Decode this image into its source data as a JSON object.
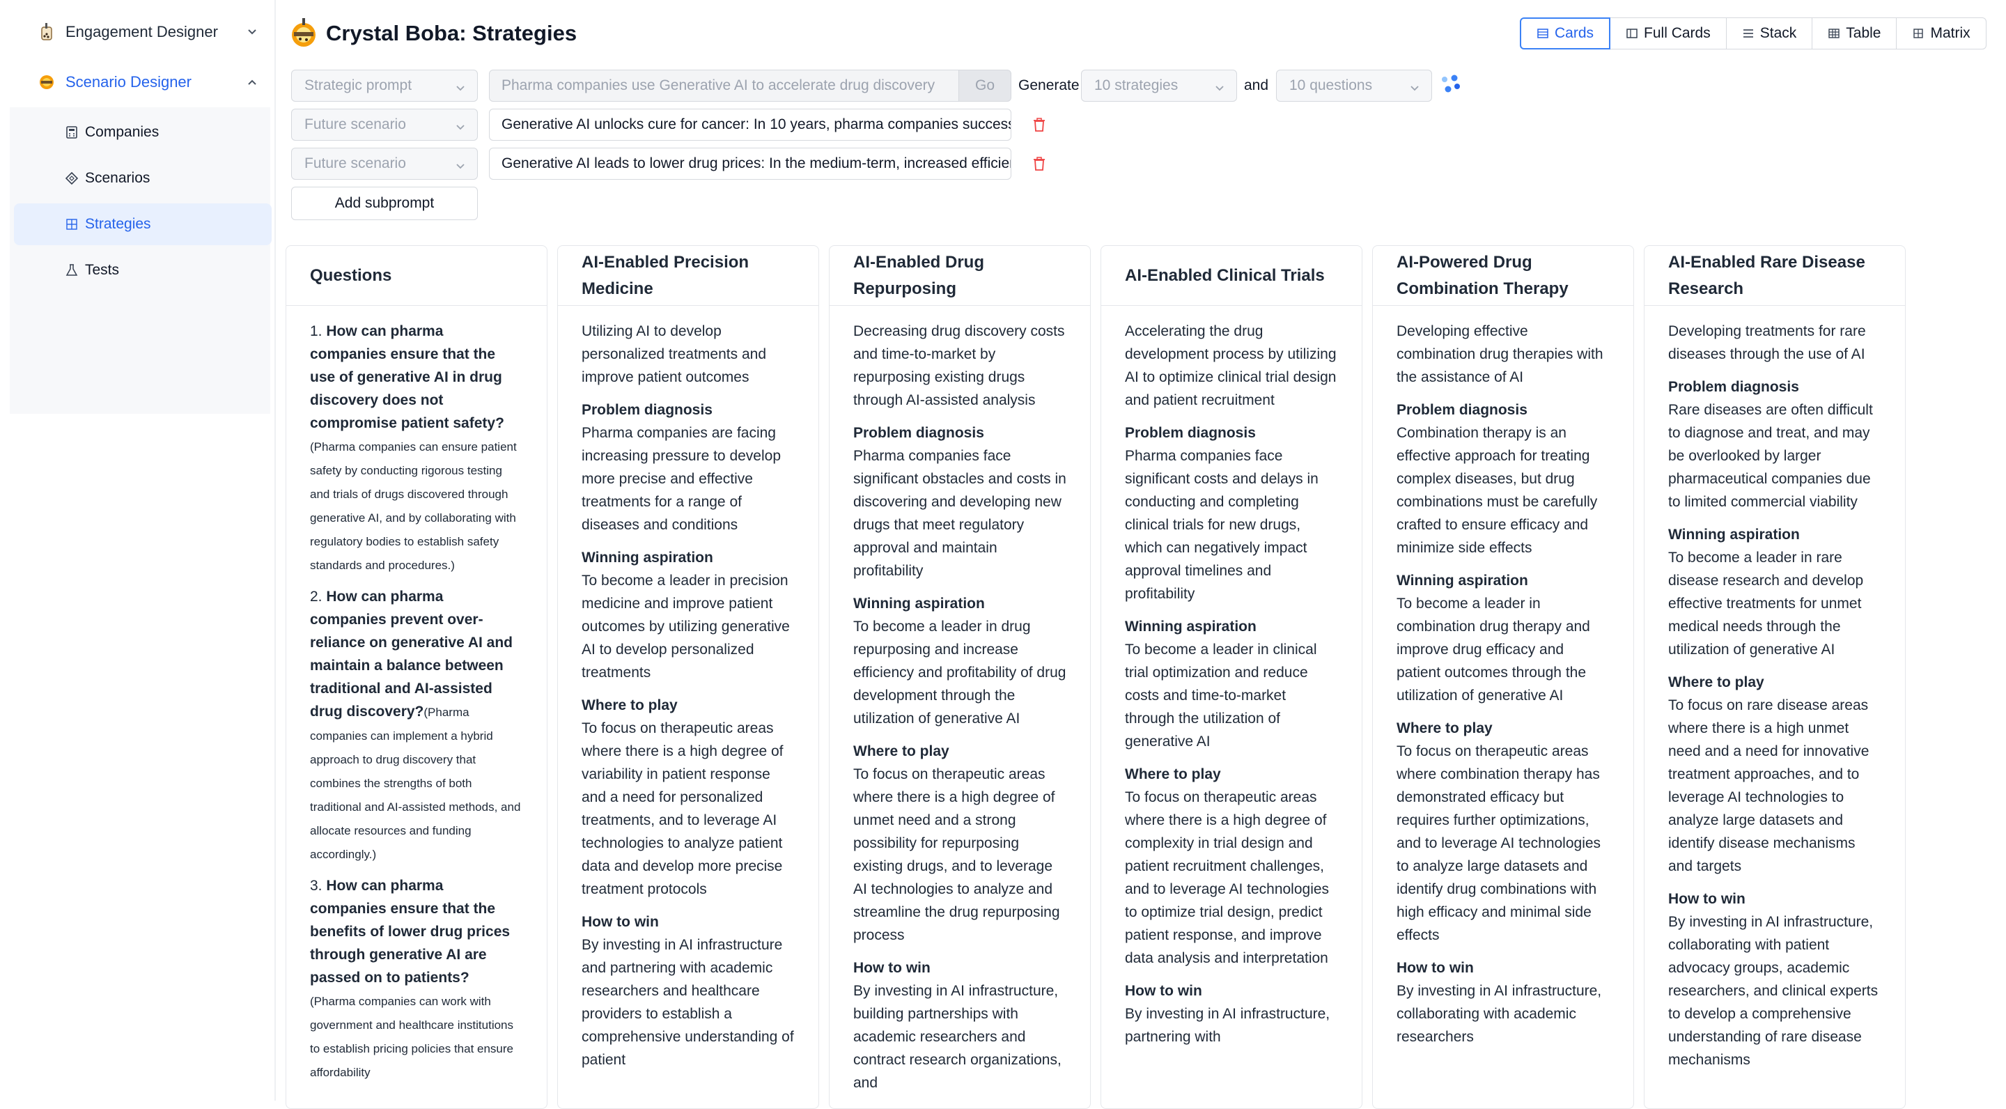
{
  "sidebar": {
    "sections": [
      {
        "label": "Engagement Designer",
        "icon": "boba-icon",
        "expanded": false
      },
      {
        "label": "Scenario Designer",
        "icon": "boba-icon",
        "expanded": true
      }
    ],
    "items": [
      {
        "label": "Companies",
        "icon": "calculator-icon",
        "active": false
      },
      {
        "label": "Scenarios",
        "icon": "diamond-icon",
        "active": false
      },
      {
        "label": "Strategies",
        "icon": "grid-icon",
        "active": true
      },
      {
        "label": "Tests",
        "icon": "flask-icon",
        "active": false
      }
    ]
  },
  "header": {
    "title": "Crystal Boba: Strategies",
    "view_tabs": [
      {
        "label": "Cards",
        "icon": "cards-icon",
        "active": true
      },
      {
        "label": "Full Cards",
        "icon": "full-cards-icon",
        "active": false
      },
      {
        "label": "Stack",
        "icon": "stack-icon",
        "active": false
      },
      {
        "label": "Table",
        "icon": "table-icon",
        "active": false
      },
      {
        "label": "Matrix",
        "icon": "matrix-icon",
        "active": false
      }
    ]
  },
  "controls": {
    "prompt_type": "Strategic prompt",
    "prompt_placeholder": "Pharma companies use Generative AI to accelerate drug discovery",
    "go_label": "Go",
    "generate_label": "Generate",
    "strategies_count": "10 strategies",
    "and_label": "and",
    "questions_count": "10 questions",
    "subprompts": [
      {
        "type": "Future scenario",
        "value": "Generative AI unlocks cure for cancer: In 10 years, pharma companies successfully"
      },
      {
        "type": "Future scenario",
        "value": "Generative AI leads to lower drug prices: In the medium-term, increased efficiency"
      }
    ],
    "add_subprompt_label": "Add subprompt"
  },
  "questions_column": {
    "title": "Questions",
    "items": [
      {
        "num": "1.",
        "question": "How can pharma companies ensure that the use of generative AI in drug discovery does not compromise patient safety?",
        "answer": "(Pharma companies can ensure patient safety by conducting rigorous testing and trials of drugs discovered through generative AI, and by collaborating with regulatory bodies to establish safety standards and procedures.)"
      },
      {
        "num": "2.",
        "question": "How can pharma companies prevent over-reliance on generative AI and maintain a balance between traditional and AI-assisted drug discovery?",
        "answer": "(Pharma companies can implement a hybrid approach to drug discovery that combines the strengths of both traditional and AI-assisted methods, and allocate resources and funding accordingly.)"
      },
      {
        "num": "3.",
        "question": "How can pharma companies ensure that the benefits of lower drug prices through generative AI are passed on to patients?",
        "answer": "(Pharma companies can work with government and healthcare institutions to establish pricing policies that ensure affordability"
      }
    ]
  },
  "section_labels": {
    "problem": "Problem diagnosis",
    "aspiration": "Winning aspiration",
    "where": "Where to play",
    "how": "How to win"
  },
  "strategies": [
    {
      "title": "AI-Enabled Precision Medicine",
      "summary": "Utilizing AI to develop personalized treatments and improve patient outcomes",
      "problem": "Pharma companies are facing increasing pressure to develop more precise and effective treatments for a range of diseases and conditions",
      "aspiration": "To become a leader in precision medicine and improve patient outcomes by utilizing generative AI to develop personalized treatments",
      "where": "To focus on therapeutic areas where there is a high degree of variability in patient response and a need for personalized treatments, and to leverage AI technologies to analyze patient data and develop more precise treatment protocols",
      "how": "By investing in AI infrastructure and partnering with academic researchers and healthcare providers to establish a comprehensive understanding of patient"
    },
    {
      "title": "AI-Enabled Drug Repurposing",
      "summary": "Decreasing drug discovery costs and time-to-market by repurposing existing drugs through AI-assisted analysis",
      "problem": "Pharma companies face significant obstacles and costs in discovering and developing new drugs that meet regulatory approval and maintain profitability",
      "aspiration": "To become a leader in drug repurposing and increase efficiency and profitability of drug development through the utilization of generative AI",
      "where": "To focus on therapeutic areas where there is a high degree of unmet need and a strong possibility for repurposing existing drugs, and to leverage AI technologies to analyze and streamline the drug repurposing process",
      "how": "By investing in AI infrastructure, building partnerships with academic researchers and contract research organizations, and"
    },
    {
      "title": "AI-Enabled Clinical Trials",
      "summary": "Accelerating the drug development process by utilizing AI to optimize clinical trial design and patient recruitment",
      "problem": "Pharma companies face significant costs and delays in conducting and completing clinical trials for new drugs, which can negatively impact approval timelines and profitability",
      "aspiration": "To become a leader in clinical trial optimization and reduce costs and time-to-market through the utilization of generative AI",
      "where": "To focus on therapeutic areas where there is a high degree of complexity in trial design and patient recruitment challenges, and to leverage AI technologies to optimize trial design, predict patient response, and improve data analysis and interpretation",
      "how": "By investing in AI infrastructure, partnering with"
    },
    {
      "title": "AI-Powered Drug Combination Therapy",
      "summary": "Developing effective combination drug therapies with the assistance of AI",
      "problem": "Combination therapy is an effective approach for treating complex diseases, but drug combinations must be carefully crafted to ensure efficacy and minimize side effects",
      "aspiration": "To become a leader in combination drug therapy and improve drug efficacy and patient outcomes through the utilization of generative AI",
      "where": "To focus on therapeutic areas where combination therapy has demonstrated efficacy but requires further optimizations, and to leverage AI technologies to analyze large datasets and identify drug combinations with high efficacy and minimal side effects",
      "how": "By investing in AI infrastructure, collaborating with academic researchers"
    },
    {
      "title": "AI-Enabled Rare Disease Research",
      "summary": "Developing treatments for rare diseases through the use of AI",
      "problem": "Rare diseases are often difficult to diagnose and treat, and may be overlooked by larger pharmaceutical companies due to limited commercial viability",
      "aspiration": "To become a leader in rare disease research and develop effective treatments for unmet medical needs through the utilization of generative AI",
      "where": "To focus on rare disease areas where there is a high unmet need and a need for innovative treatment approaches, and to leverage AI technologies to analyze large datasets and identify disease mechanisms and targets",
      "how": "By investing in AI infrastructure, collaborating with patient advocacy groups, academic researchers, and clinical experts to develop a comprehensive understanding of rare disease mechanisms"
    }
  ],
  "colors": {
    "accent": "#2563eb",
    "active_bg": "#e8f0fe",
    "border": "#e5e7eb",
    "trash": "#ef4444"
  }
}
